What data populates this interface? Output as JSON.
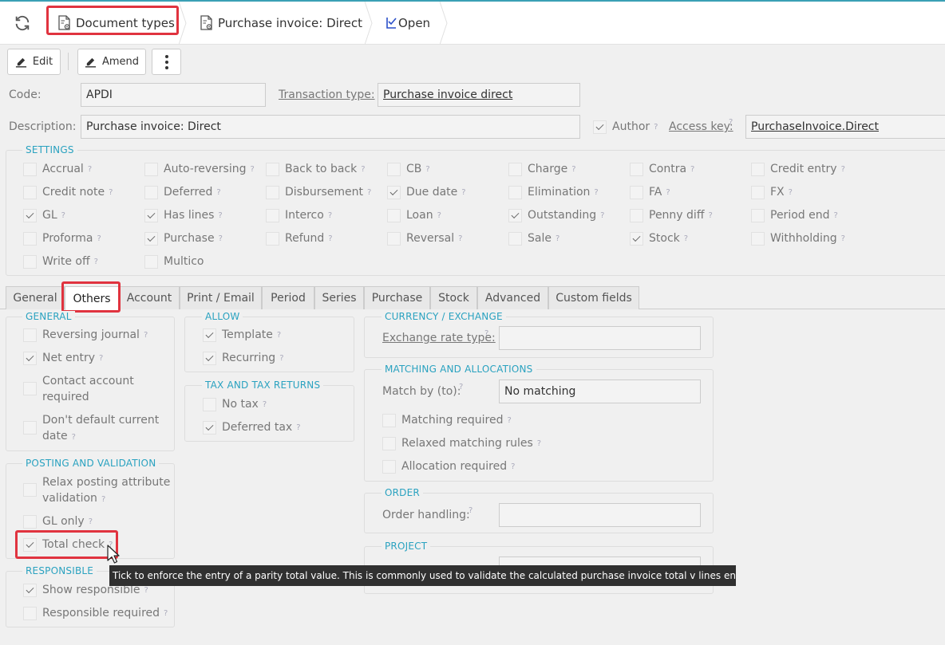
{
  "breadcrumbs": [
    {
      "label": "Document types"
    },
    {
      "label": "Purchase invoice: Direct"
    },
    {
      "label": "Open"
    }
  ],
  "toolbar": {
    "edit_label": "Edit",
    "amend_label": "Amend",
    "more_icon": "more-vertical-icon"
  },
  "header": {
    "code_label": "Code:",
    "code_value": "APDI",
    "transaction_type_label": "Transaction type:",
    "transaction_type_value": "Purchase invoice direct",
    "description_label": "Description:",
    "description_value": "Purchase invoice: Direct",
    "author_label": "Author",
    "author_checked": true,
    "access_key_label": "Access key:",
    "access_key_value": "PurchaseInvoice.Direct"
  },
  "settings": {
    "title": "SETTINGS",
    "items": [
      {
        "label": "Accrual",
        "checked": false
      },
      {
        "label": "Auto-reversing",
        "checked": false
      },
      {
        "label": "Back to back",
        "checked": false
      },
      {
        "label": "CB",
        "checked": false
      },
      {
        "label": "Charge",
        "checked": false
      },
      {
        "label": "Contra",
        "checked": false
      },
      {
        "label": "Credit entry",
        "checked": false
      },
      {
        "label": "Credit note",
        "checked": false
      },
      {
        "label": "Deferred",
        "checked": false
      },
      {
        "label": "Disbursement",
        "checked": false
      },
      {
        "label": "Due date",
        "checked": true
      },
      {
        "label": "Elimination",
        "checked": false
      },
      {
        "label": "FA",
        "checked": false
      },
      {
        "label": "FX",
        "checked": false
      },
      {
        "label": "GL",
        "checked": true
      },
      {
        "label": "Has lines",
        "checked": true
      },
      {
        "label": "Interco",
        "checked": false
      },
      {
        "label": "Loan",
        "checked": false
      },
      {
        "label": "Outstanding",
        "checked": true
      },
      {
        "label": "Penny diff",
        "checked": false
      },
      {
        "label": "Period end",
        "checked": false
      },
      {
        "label": "Proforma",
        "checked": false
      },
      {
        "label": "Purchase",
        "checked": true
      },
      {
        "label": "Refund",
        "checked": false
      },
      {
        "label": "Reversal",
        "checked": false
      },
      {
        "label": "Sale",
        "checked": false
      },
      {
        "label": "Stock",
        "checked": true
      },
      {
        "label": "Withholding",
        "checked": false
      },
      {
        "label": "Write off",
        "checked": false
      },
      {
        "label": "Multico",
        "checked": false
      }
    ]
  },
  "tabs": [
    {
      "label": "General"
    },
    {
      "label": "Others"
    },
    {
      "label": "Account"
    },
    {
      "label": "Print / Email"
    },
    {
      "label": "Period"
    },
    {
      "label": "Series"
    },
    {
      "label": "Purchase"
    },
    {
      "label": "Stock"
    },
    {
      "label": "Advanced"
    },
    {
      "label": "Custom fields"
    }
  ],
  "active_tab": "Others",
  "general_group": {
    "title": "GENERAL",
    "items": [
      {
        "label": "Reversing journal",
        "checked": false
      },
      {
        "label": "Net entry",
        "checked": true
      },
      {
        "line1": "Contact account",
        "line2": "required",
        "checked": false
      },
      {
        "line1": "Don't default current",
        "line2": "date",
        "checked": false
      }
    ]
  },
  "posting_group": {
    "title": "POSTING AND VALIDATION",
    "items": [
      {
        "line1": "Relax posting attribute",
        "line2": "validation",
        "checked": false
      },
      {
        "label": "GL only",
        "checked": false
      },
      {
        "label": "Total check",
        "checked": true
      }
    ]
  },
  "responsible_group": {
    "title": "RESPONSIBLE",
    "items": [
      {
        "label": "Show responsible",
        "checked": true
      },
      {
        "label": "Responsible required",
        "checked": false
      }
    ]
  },
  "allow_group": {
    "title": "ALLOW",
    "items": [
      {
        "label": "Template",
        "checked": true
      },
      {
        "label": "Recurring",
        "checked": true
      }
    ]
  },
  "tax_group": {
    "title": "TAX AND TAX RETURNS",
    "items": [
      {
        "label": "No tax",
        "checked": false
      },
      {
        "label": "Deferred tax",
        "checked": true
      }
    ]
  },
  "currency_group": {
    "title": "CURRENCY / EXCHANGE",
    "exchange_rate_type_label": "Exchange rate type:",
    "exchange_rate_type_value": ""
  },
  "matching_group": {
    "title": "MATCHING AND ALLOCATIONS",
    "match_by_label": "Match by (to):",
    "match_by_value": "No matching",
    "items": [
      {
        "label": "Matching required",
        "checked": false
      },
      {
        "label": "Relaxed matching rules",
        "checked": false
      },
      {
        "label": "Allocation required",
        "checked": false
      }
    ]
  },
  "order_group": {
    "title": "ORDER",
    "order_handling_label": "Order handling:",
    "order_handling_value": ""
  },
  "project_group": {
    "title": "PROJECT"
  },
  "help_mark": "?",
  "tooltip": "Tick to enforce the entry of a parity total value. This is commonly used to validate the calculated purchase invoice total v lines entered.",
  "colors": {
    "accent": "#2aa2c0",
    "highlight": "#e0333f",
    "tooltip_bg": "#303030"
  }
}
